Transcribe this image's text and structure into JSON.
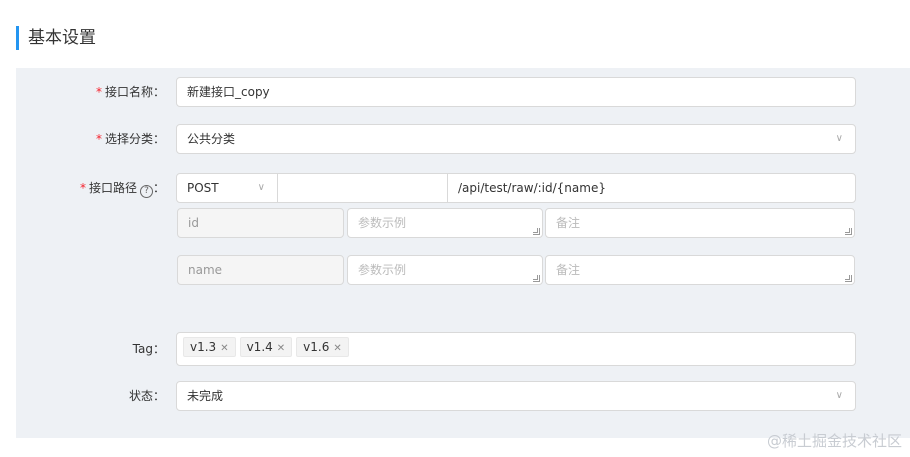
{
  "section": {
    "title": "基本设置"
  },
  "form": {
    "name": {
      "label": "接口名称：",
      "value": "新建接口_copy"
    },
    "category": {
      "label": "选择分类：",
      "value": "公共分类"
    },
    "path": {
      "label": "接口路径",
      "colon": "：",
      "method": "POST",
      "prefix": "",
      "value": "/api/test/raw/:id/{name}",
      "params": [
        {
          "name": "id",
          "example_placeholder": "参数示例",
          "note_placeholder": "备注"
        },
        {
          "name": "name",
          "example_placeholder": "参数示例",
          "note_placeholder": "备注"
        }
      ]
    },
    "tag": {
      "label": "Tag：",
      "items": [
        "v1.3",
        "v1.4",
        "v1.6"
      ]
    },
    "status": {
      "label": "状态：",
      "value": "未完成"
    }
  },
  "watermark": "@稀土掘金技术社区",
  "icons": {
    "required": "*",
    "help": "?",
    "chevron": "∨",
    "close": "✕"
  }
}
